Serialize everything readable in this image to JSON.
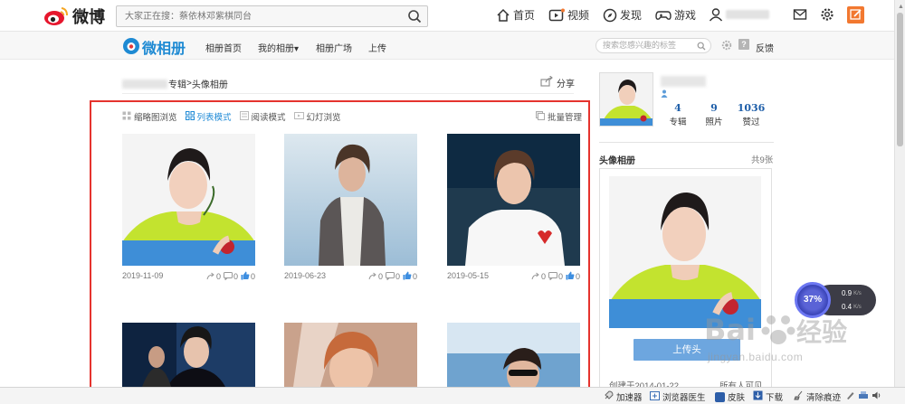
{
  "topbar": {
    "logo_text": "微博",
    "search_placeholder": "大家正在搜：蔡依林邓紫棋同台",
    "nav": [
      {
        "label": "首页",
        "icon": "home-icon"
      },
      {
        "label": "视频",
        "icon": "video-icon"
      },
      {
        "label": "发现",
        "icon": "discover-icon"
      },
      {
        "label": "游戏",
        "icon": "game-icon"
      }
    ]
  },
  "subnav": {
    "logo_text": "微相册",
    "links": [
      "相册首页",
      "我的相册",
      "相册广场",
      "上传"
    ],
    "my_album_caret": "▾",
    "search_placeholder": "搜索您感兴趣的标签",
    "feedback": "反馈"
  },
  "breadcrumb": {
    "album_link": "专辑",
    "separator": " > ",
    "current": "头像相册",
    "share_label": "分享"
  },
  "view_modes": [
    {
      "label": "缩略图浏览",
      "active": false
    },
    {
      "label": "列表模式",
      "active": true
    },
    {
      "label": "阅读模式",
      "active": false
    },
    {
      "label": "幻灯浏览",
      "active": false
    }
  ],
  "batch_label": "批量管理",
  "photos": [
    {
      "date": "2019-11-09",
      "forwards": "0",
      "comments": "0",
      "likes": "0"
    },
    {
      "date": "2019-06-23",
      "forwards": "0",
      "comments": "0",
      "likes": "0"
    },
    {
      "date": "2019-05-15",
      "forwards": "0",
      "comments": "0",
      "likes": "0"
    }
  ],
  "profile": {
    "stats": [
      {
        "value": "4",
        "label": "专辑"
      },
      {
        "value": "9",
        "label": "照片"
      },
      {
        "value": "1036",
        "label": "赞过"
      }
    ]
  },
  "sidebar": {
    "album_title": "头像相册",
    "album_count": "共9张",
    "upload_label": "上传头",
    "created": "创建于2014-01-22",
    "visibility": "所有人可见"
  },
  "speed_widget": {
    "percent": "37%",
    "up": "0.9",
    "up_unit": "K/s",
    "down": "0.4",
    "down_unit": "K/s"
  },
  "statusbar": {
    "items": [
      "加速器",
      "浏览器医生",
      "皮肤",
      "下载",
      "清除痕迹"
    ]
  },
  "watermark": {
    "main": "Bai",
    "main2": "经验",
    "sub": "jingyan.baidu.com"
  },
  "colors": {
    "accent_blue": "#1f8ad6",
    "highlight_red": "#e5332e",
    "compose_orange": "#f27830",
    "upload_blue": "#6da6df"
  }
}
